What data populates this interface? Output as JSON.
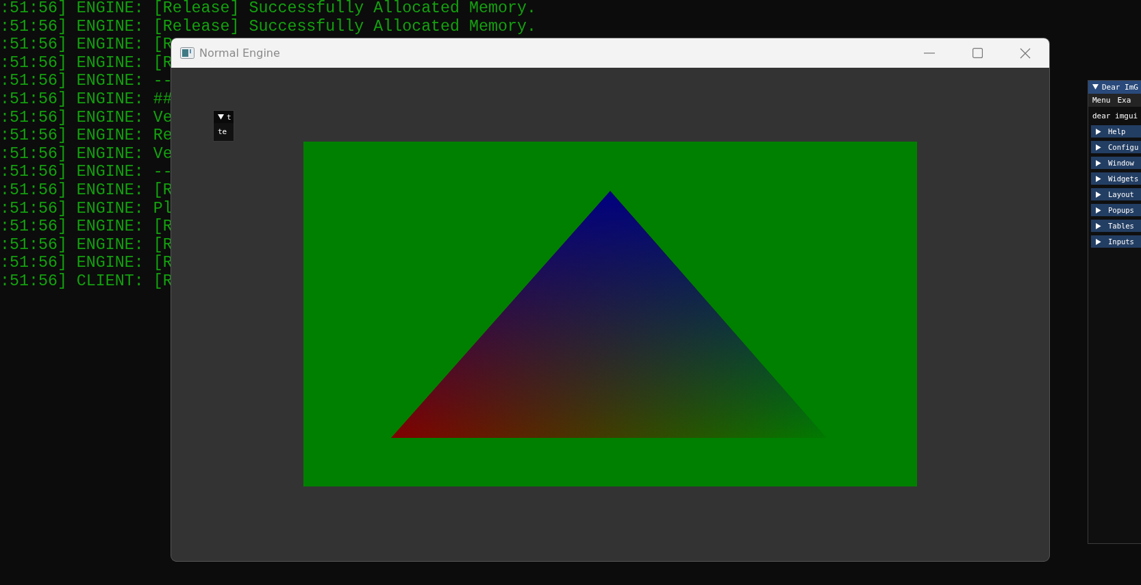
{
  "console": {
    "lines": [
      ":51:56] ENGINE: [Release] Successfully Allocated Memory.",
      ":51:56] ENGINE: [Release] Successfully Allocated Memory.",
      ":51:56] ENGINE: [R",
      ":51:56] ENGINE: [R",
      ":51:56] ENGINE: --",
      ":51:56] ENGINE: ##",
      ":51:56] ENGINE: Ve",
      ":51:56] ENGINE: Re",
      ":51:56] ENGINE: Ve",
      ":51:56] ENGINE: --",
      ":51:56] ENGINE: [R",
      ":51:56] ENGINE: Pl",
      ":51:56] ENGINE: [R",
      ":51:56] ENGINE: [R",
      ":51:56] ENGINE: [R",
      ":51:56] CLIENT: [R"
    ]
  },
  "window": {
    "title": "Normal Engine",
    "small_panel": {
      "title": "t",
      "expanded": true,
      "body": "te"
    }
  },
  "imgui": {
    "title": "Dear ImG",
    "expanded": true,
    "menu": [
      "Menu",
      "Exa"
    ],
    "text": "dear imgui",
    "headers": [
      {
        "label": "Help",
        "expanded": false
      },
      {
        "label": "Configu",
        "expanded": false
      },
      {
        "label": "Window",
        "expanded": false
      },
      {
        "label": "Widgets",
        "expanded": false
      },
      {
        "label": "Layout",
        "expanded": false
      },
      {
        "label": "Popups",
        "expanded": false
      },
      {
        "label": "Tables",
        "expanded": false
      },
      {
        "label": "Inputs",
        "expanded": false
      }
    ]
  }
}
